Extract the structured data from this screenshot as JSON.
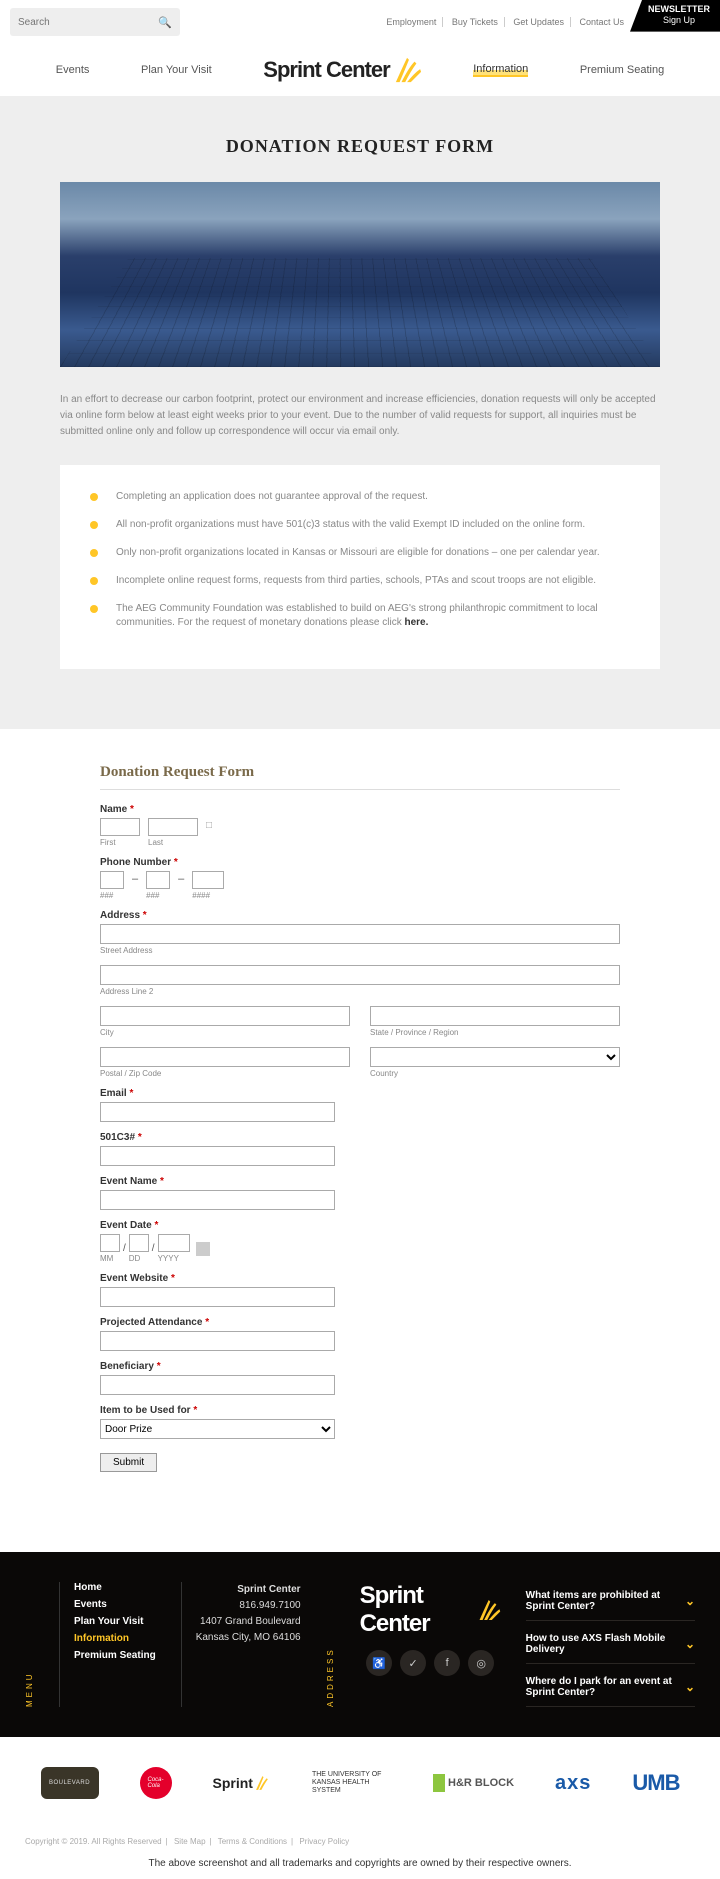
{
  "top": {
    "search_placeholder": "Search",
    "links": [
      "Employment",
      "Buy Tickets",
      "Get Updates",
      "Contact Us"
    ],
    "newsletter_line1": "NEWSLETTER",
    "newsletter_line2": "Sign Up"
  },
  "nav": {
    "events": "Events",
    "plan": "Plan Your Visit",
    "logo": "Sprint Center",
    "info": "Information",
    "premium": "Premium Seating"
  },
  "page": {
    "title": "DONATION REQUEST FORM",
    "intro": "In an effort to decrease our carbon footprint, protect our environment and increase efficiencies, donation requests will only be accepted via online form below at least eight weeks prior to your event. Due to the number of valid requests for support, all inquiries must be submitted online only and follow up correspondence will occur via email only.",
    "bullets": [
      "Completing an application does not guarantee approval of the request.",
      "All non-profit organizations must have 501(c)3 status with the valid Exempt ID included on the online form.",
      "Only non-profit organizations located in Kansas or Missouri are eligible for donations – one per calendar year.",
      "Incomplete online request forms, requests from third parties, schools, PTAs and scout troops are not eligible.",
      "The AEG Community Foundation was established to build on AEG's strong philanthropic commitment to local communities. For the request of monetary donations please click "
    ],
    "here": "here."
  },
  "form": {
    "heading": "Donation Request Form",
    "name": "Name",
    "first": "First",
    "last": "Last",
    "phone": "Phone Number",
    "phone_a": "###",
    "phone_b": "###",
    "phone_c": "####",
    "address": "Address",
    "street": "Street Address",
    "line2": "Address Line 2",
    "city": "City",
    "state": "State / Province / Region",
    "zip": "Postal / Zip Code",
    "country": "Country",
    "email": "Email",
    "c3": "501C3#",
    "event_name": "Event Name",
    "event_date": "Event Date",
    "mm": "MM",
    "dd": "DD",
    "yyyy": "YYYY",
    "website": "Event Website",
    "attendance": "Projected Attendance",
    "beneficiary": "Beneficiary",
    "item_used": "Item to be Used for",
    "item_default": "Door Prize",
    "submit": "Submit"
  },
  "footer": {
    "menu_label": "MENU",
    "menu": [
      "Home",
      "Events",
      "Plan Your Visit",
      "Information",
      "Premium Seating"
    ],
    "addr_label": "ADDRESS",
    "addr_name": "Sprint Center",
    "addr_phone": "816.949.7100",
    "addr_street": "1407 Grand Boulevard",
    "addr_city": "Kansas City, MO 64106",
    "faq": [
      "What items are prohibited at Sprint Center?",
      "How to use AXS Flash Mobile Delivery",
      "Where do I park for an event at Sprint Center?"
    ]
  },
  "sponsors": {
    "sprint": "Sprint",
    "ku": "THE UNIVERSITY OF KANSAS HEALTH SYSTEM",
    "hrb": "H&R BLOCK",
    "axs": "axs",
    "umb": "UMB"
  },
  "bottom": {
    "copy": "Copyright © 2019. All Rights Reserved",
    "sitemap": "Site Map",
    "terms": "Terms & Conditions",
    "privacy": "Privacy Policy",
    "disclaimer": "The above screenshot and all trademarks and copyrights are owned by their respective owners."
  }
}
